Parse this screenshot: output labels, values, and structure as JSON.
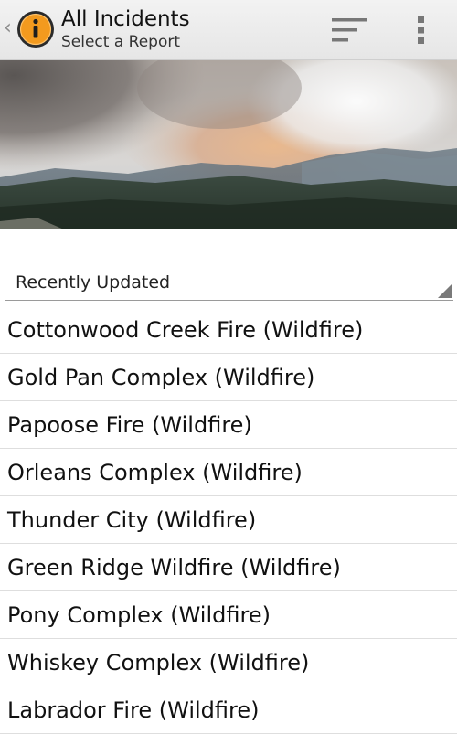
{
  "actionbar": {
    "title": "All Incidents",
    "subtitle": "Select a Report",
    "icons": {
      "up": "chevron-left-icon",
      "app": "info-icon",
      "filter": "filter-sort-icon",
      "overflow": "overflow-menu-icon"
    },
    "up_glyph": "‹",
    "app_glyph": "i",
    "accent": "#f39a1e"
  },
  "filter_spinner": {
    "selected": "Recently Updated"
  },
  "incidents": [
    "Cottonwood Creek Fire (Wildfire)",
    "Gold Pan Complex (Wildfire)",
    "Papoose Fire (Wildfire)",
    "Orleans Complex (Wildfire)",
    "Thunder City (Wildfire)",
    "Green Ridge Wildfire (Wildfire)",
    "Pony Complex (Wildfire)",
    "Whiskey Complex (Wildfire)",
    "Labrador Fire (Wildfire)"
  ]
}
